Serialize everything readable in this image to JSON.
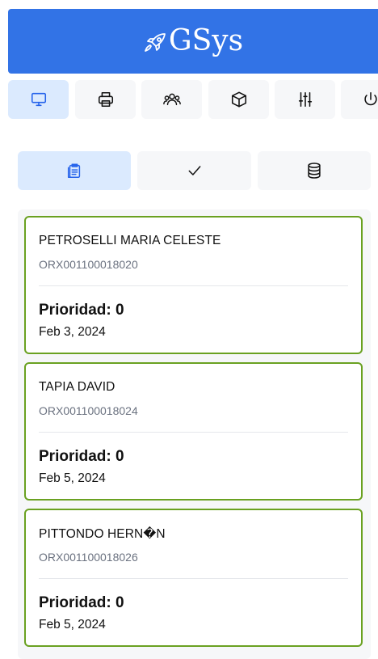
{
  "header": {
    "brand": "GSys",
    "logo_icon": "rocket-icon",
    "background": "#3273e6"
  },
  "nav": {
    "items": [
      {
        "icon": "monitor-icon",
        "active": true
      },
      {
        "icon": "printer-icon",
        "active": false
      },
      {
        "icon": "users-icon",
        "active": false
      },
      {
        "icon": "box-icon",
        "active": false
      },
      {
        "icon": "sliders-icon",
        "active": false
      },
      {
        "icon": "power-icon",
        "active": false
      }
    ]
  },
  "tabs": {
    "items": [
      {
        "icon": "clipboard-list-icon",
        "active": true
      },
      {
        "icon": "check-icon",
        "active": false
      },
      {
        "icon": "database-icon",
        "active": false
      }
    ]
  },
  "orders": [
    {
      "name": "PETROSELLI MARIA CELESTE",
      "code": "ORX001100018020",
      "priority": "Prioridad: 0",
      "date": "Feb 3, 2024"
    },
    {
      "name": "TAPIA DAVID",
      "code": "ORX001100018024",
      "priority": "Prioridad: 0",
      "date": "Feb 5, 2024"
    },
    {
      "name": "PITTONDO HERN�N",
      "code": "ORX001100018026",
      "priority": "Prioridad: 0",
      "date": "Feb 5, 2024"
    }
  ],
  "colors": {
    "accent": "#3273e6",
    "active_bg": "#dbeafe",
    "card_border": "#6aa121",
    "muted_text": "#6b7280"
  }
}
